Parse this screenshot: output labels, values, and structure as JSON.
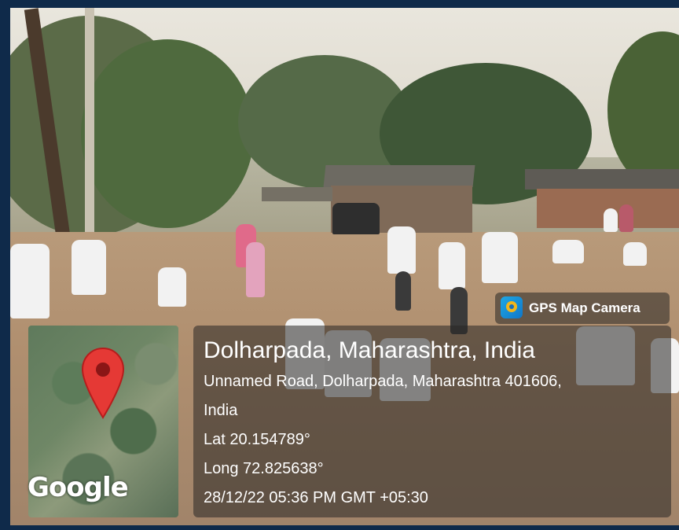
{
  "app": {
    "name": "GPS Map Camera",
    "icon": "gps-map-camera-icon"
  },
  "location": {
    "title": "Dolharpada, Maharashtra, India",
    "address_line1": "Unnamed Road, Dolharpada, Maharashtra 401606,",
    "address_line2": "India",
    "latitude": "Lat 20.154789°",
    "longitude": "Long 72.825638°",
    "timestamp": "28/12/22 05:36 PM GMT +05:30"
  },
  "map": {
    "provider_label": "Google",
    "marker_icon": "map-pin-icon"
  },
  "colors": {
    "pin_red": "#e53935",
    "border": "#0f2a4a"
  }
}
